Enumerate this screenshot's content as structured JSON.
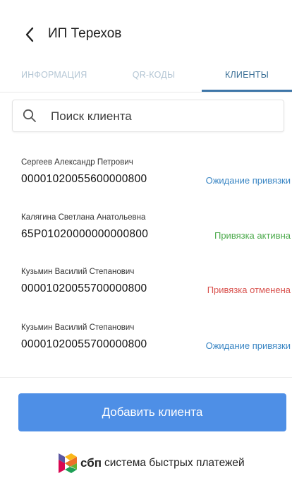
{
  "header": {
    "title": "ИП Терехов",
    "back_icon": "chevron-left-icon"
  },
  "tabs": [
    {
      "label": "ИНФОРМАЦИЯ",
      "active": false
    },
    {
      "label": "QR-КОДЫ",
      "active": false
    },
    {
      "label": "КЛИЕНТЫ",
      "active": true
    }
  ],
  "search": {
    "placeholder": "Поиск клиента",
    "value": "",
    "icon": "search-icon"
  },
  "clients": [
    {
      "name": "Сергеев Александр Петрович",
      "account": "00001020055600000800",
      "status": "Ожидание привязки",
      "status_color": "#3a86c4"
    },
    {
      "name": "Калягина Светлана Анатольевна",
      "account": "65Р01020000000000800",
      "status": "Привязка активна",
      "status_color": "#4caa4c"
    },
    {
      "name": "Кузьмин Василий Степанович",
      "account": "00001020055700000800",
      "status": "Привязка отменена",
      "status_color": "#d9534f"
    },
    {
      "name": "Кузьмин Василий Степанович",
      "account": "00001020055700000800",
      "status": "Ожидание привязки",
      "status_color": "#3a86c4"
    }
  ],
  "add_button": {
    "label": "Добавить клиента",
    "color": "#4e8fe6"
  },
  "footer": {
    "brand": "сбп",
    "tagline": "система быстрых платежей"
  }
}
